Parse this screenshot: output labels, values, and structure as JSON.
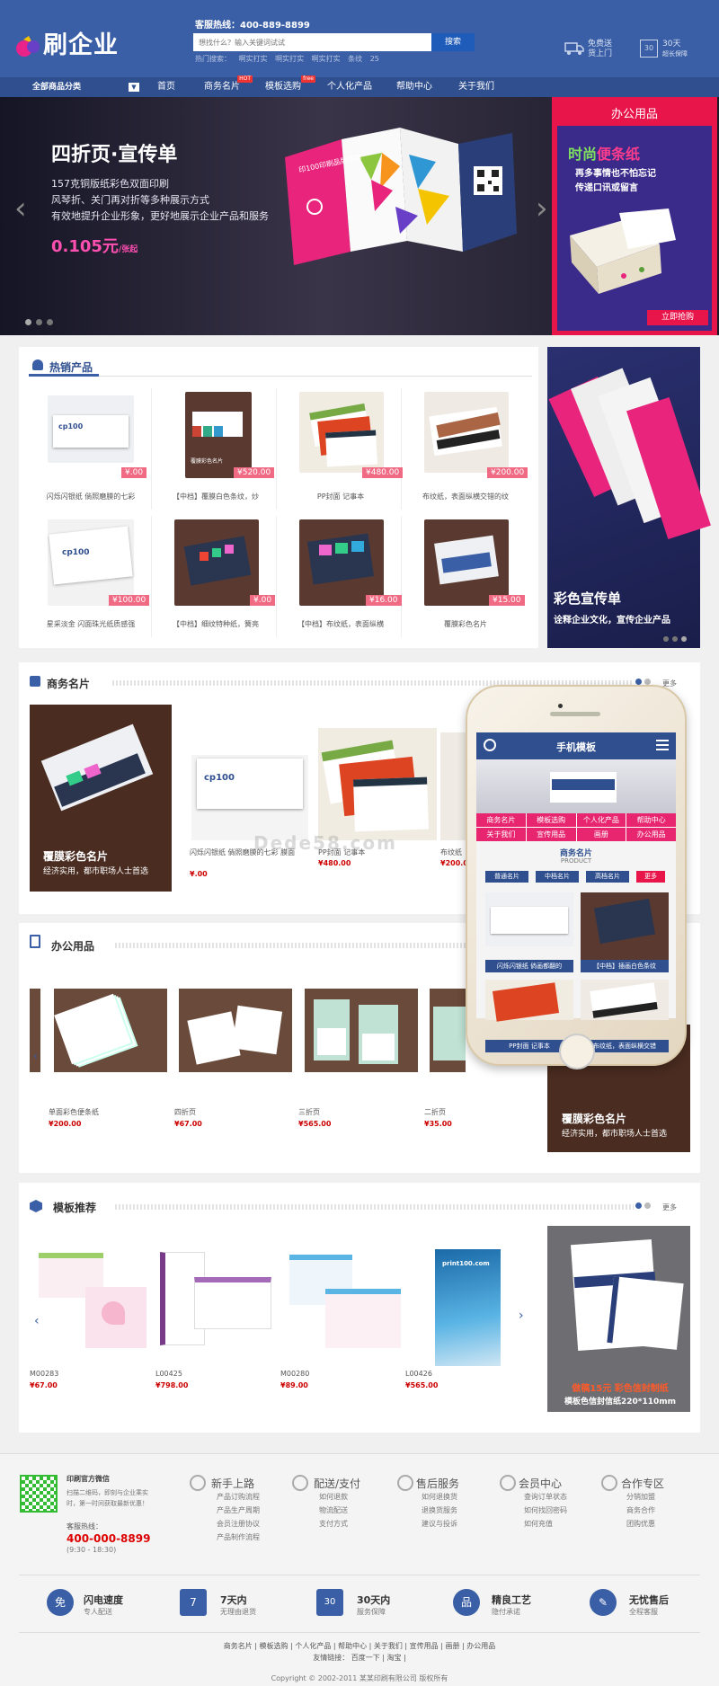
{
  "header": {
    "logo": "刷企业",
    "hotline": "客服热线：400-889-8899",
    "search_placeholder": "想找什么？输入关键词试试",
    "search_button": "搜索",
    "hotwords": "热门搜索：  啊实打实  啊实打实  啊实打实  条纹  25",
    "badge1_line1": "免费送",
    "badge1_line2": "货上门",
    "badge2_line1": "30天",
    "badge2_line2": "超长保障",
    "badge2_num": "30"
  },
  "nav": {
    "category": "全部商品分类",
    "items": [
      {
        "label": "首页",
        "tag": ""
      },
      {
        "label": "商务名片",
        "tag": "HOT"
      },
      {
        "label": "模板选购",
        "tag": "free"
      },
      {
        "label": "个人化产品",
        "tag": ""
      },
      {
        "label": "帮助中心",
        "tag": ""
      },
      {
        "label": "关于我们",
        "tag": ""
      }
    ]
  },
  "banner": {
    "title": "四折页·宣传单",
    "line1": "157克铜版纸彩色双面印刷",
    "line2": "风琴折、关门再对折等多种展示方式",
    "line3": "有效地提升企业形象，更好地展示企业产品和服务",
    "price": "0.105元",
    "price_unit": "/张起",
    "pamphlet_text": "印100印刷品牌保障",
    "side_title": "办公用品",
    "side_h_a": "时尚",
    "side_h_b": "便条纸",
    "side_l1": "再多事情也不怕忘记",
    "side_l2": "传递口讯或留言",
    "side_button": "立即抢购"
  },
  "hot": {
    "title": "热销产品",
    "items": [
      {
        "price": "¥.00",
        "name": "闪烁闪银纸 倘照磨膜的七彩"
      },
      {
        "price": "¥520.00",
        "name": "【中档】覆膜白色条纹，炒"
      },
      {
        "price": "¥480.00",
        "name": "PP封面 记事本"
      },
      {
        "price": "¥200.00",
        "name": "布纹纸，表面纵横交错的纹"
      },
      {
        "price": "¥100.00",
        "name": "星采淡金 闪面珠光纸质感强"
      },
      {
        "price": "¥.00",
        "name": "【中档】细纹特种纸，簧亮"
      },
      {
        "price": "¥16.00",
        "name": "【中档】布纹纸，表面纵横"
      },
      {
        "price": "¥15.00",
        "name": "覆膜彩色名片"
      }
    ],
    "card_label": "覆膜彩色名片",
    "ad_title": "彩色宣传单",
    "ad_sub": "诠释企业文化，宣传企业产品"
  },
  "biz": {
    "title": "商务名片",
    "more": "更多",
    "feature_title": "覆膜彩色名片",
    "feature_sub": "经济实用，都市职场人士首选",
    "items": [
      {
        "name": "闪烁闪银纸 倘照磨膜的七彩 膜面",
        "price": "¥.00"
      },
      {
        "name": "PP封面 记事本",
        "price": "¥480.00"
      },
      {
        "name": "布纹纸",
        "price": "¥200.00"
      }
    ],
    "watermark": "Dede58.com"
  },
  "office": {
    "title": "办公用品",
    "items": [
      {
        "name": "单面彩色便条纸",
        "price": "¥200.00"
      },
      {
        "name": "四折页",
        "price": "¥67.00"
      },
      {
        "name": "三折页",
        "price": "¥565.00"
      },
      {
        "name": "二折页",
        "price": "¥35.00"
      }
    ],
    "feature_title": "覆膜彩色名片",
    "feature_sub": "经济实用，都市职场人士首选"
  },
  "tpl": {
    "title": "模板推荐",
    "more": "更多",
    "items": [
      {
        "code": "M00283",
        "price": "¥67.00"
      },
      {
        "code": "L00425",
        "price": "¥798.00"
      },
      {
        "code": "M00280",
        "price": "¥89.00"
      },
      {
        "code": "L00426",
        "price": "¥565.00"
      }
    ],
    "ad_title": "做稿15元 彩色信封制纸",
    "ad_sub": "模板色信封信纸220*110mm",
    "envelope_text": "print100.com"
  },
  "phone": {
    "title": "手机模板",
    "menu": [
      "商务名片",
      "模板选购",
      "个人化产品",
      "帮助中心",
      "关于我们",
      "宣传用品",
      "画册",
      "办公用品"
    ],
    "section": "商务名片",
    "section_en": "PRODUCT",
    "tabs": [
      "普通名片",
      "中档名片",
      "高档名片",
      "更多"
    ],
    "cards": [
      "闪烁闪银纸 倘画都翻的",
      "【中档】插画白色条纹",
      "PP封面 记事本",
      "布纹纸，表面纵横交错"
    ]
  },
  "footer": {
    "qr_title": "印刷官方微信",
    "qr_text1": "扫描二维码，即刻与企业乘实",
    "qr_text2": "时，第一时间获取最新优惠！",
    "hotline_label": "客服热线：",
    "hotline": "400-000-8899",
    "hours": "(9:30 - 18:30)",
    "cols": [
      {
        "title": "新手上路",
        "items": [
          "产品订购流程",
          "产品生产周期",
          "会员注册协议",
          "产品制作流程"
        ]
      },
      {
        "title": "配送/支付",
        "items": [
          "如何退款",
          "物流配送",
          "支付方式"
        ]
      },
      {
        "title": "售后服务",
        "items": [
          "如何退换货",
          "退换货服务",
          "建议与投诉"
        ]
      },
      {
        "title": "会员中心",
        "items": [
          "查询订单状态",
          "如何找回密码",
          "如何充值"
        ]
      },
      {
        "title": "合作专区",
        "items": [
          "分销加盟",
          "商务合作",
          "团购优惠"
        ]
      }
    ],
    "badges": [
      {
        "t": "闪电速度",
        "s": "专人配送",
        "icon": "免"
      },
      {
        "t": "7天内",
        "s": "无理由退货",
        "icon": "7"
      },
      {
        "t": "30天内",
        "s": "服务保障",
        "icon": "30"
      },
      {
        "t": "精良工艺",
        "s": "隐付承诺",
        "icon": "品"
      },
      {
        "t": "无忧售后",
        "s": "全程客服",
        "icon": "✎"
      }
    ],
    "links": "商务名片 | 模板选购 | 个人化产品 | 帮助中心 | 关于我们 | 宣传用品 | 画册 | 办公用品",
    "friend": "友情链接：  百度一下 | 淘宝 |",
    "copyright": "Copyright © 2002-2011 某某印刷有限公司 版权所有"
  }
}
